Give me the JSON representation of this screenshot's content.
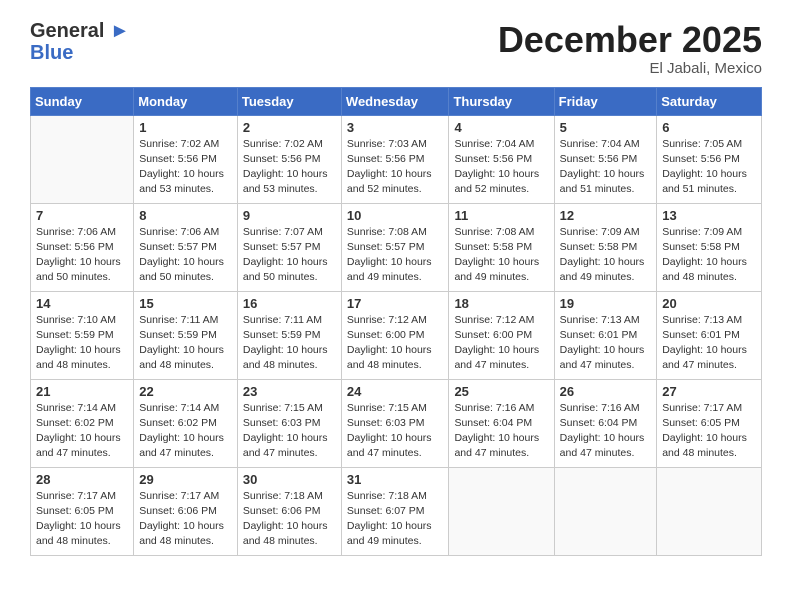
{
  "header": {
    "logo_line1": "General",
    "logo_line2": "Blue",
    "title": "December 2025",
    "subtitle": "El Jabali, Mexico"
  },
  "days_of_week": [
    "Sunday",
    "Monday",
    "Tuesday",
    "Wednesday",
    "Thursday",
    "Friday",
    "Saturday"
  ],
  "weeks": [
    [
      {
        "day": "",
        "info": ""
      },
      {
        "day": "1",
        "info": "Sunrise: 7:02 AM\nSunset: 5:56 PM\nDaylight: 10 hours\nand 53 minutes."
      },
      {
        "day": "2",
        "info": "Sunrise: 7:02 AM\nSunset: 5:56 PM\nDaylight: 10 hours\nand 53 minutes."
      },
      {
        "day": "3",
        "info": "Sunrise: 7:03 AM\nSunset: 5:56 PM\nDaylight: 10 hours\nand 52 minutes."
      },
      {
        "day": "4",
        "info": "Sunrise: 7:04 AM\nSunset: 5:56 PM\nDaylight: 10 hours\nand 52 minutes."
      },
      {
        "day": "5",
        "info": "Sunrise: 7:04 AM\nSunset: 5:56 PM\nDaylight: 10 hours\nand 51 minutes."
      },
      {
        "day": "6",
        "info": "Sunrise: 7:05 AM\nSunset: 5:56 PM\nDaylight: 10 hours\nand 51 minutes."
      }
    ],
    [
      {
        "day": "7",
        "info": "Sunrise: 7:06 AM\nSunset: 5:56 PM\nDaylight: 10 hours\nand 50 minutes."
      },
      {
        "day": "8",
        "info": "Sunrise: 7:06 AM\nSunset: 5:57 PM\nDaylight: 10 hours\nand 50 minutes."
      },
      {
        "day": "9",
        "info": "Sunrise: 7:07 AM\nSunset: 5:57 PM\nDaylight: 10 hours\nand 50 minutes."
      },
      {
        "day": "10",
        "info": "Sunrise: 7:08 AM\nSunset: 5:57 PM\nDaylight: 10 hours\nand 49 minutes."
      },
      {
        "day": "11",
        "info": "Sunrise: 7:08 AM\nSunset: 5:58 PM\nDaylight: 10 hours\nand 49 minutes."
      },
      {
        "day": "12",
        "info": "Sunrise: 7:09 AM\nSunset: 5:58 PM\nDaylight: 10 hours\nand 49 minutes."
      },
      {
        "day": "13",
        "info": "Sunrise: 7:09 AM\nSunset: 5:58 PM\nDaylight: 10 hours\nand 48 minutes."
      }
    ],
    [
      {
        "day": "14",
        "info": "Sunrise: 7:10 AM\nSunset: 5:59 PM\nDaylight: 10 hours\nand 48 minutes."
      },
      {
        "day": "15",
        "info": "Sunrise: 7:11 AM\nSunset: 5:59 PM\nDaylight: 10 hours\nand 48 minutes."
      },
      {
        "day": "16",
        "info": "Sunrise: 7:11 AM\nSunset: 5:59 PM\nDaylight: 10 hours\nand 48 minutes."
      },
      {
        "day": "17",
        "info": "Sunrise: 7:12 AM\nSunset: 6:00 PM\nDaylight: 10 hours\nand 48 minutes."
      },
      {
        "day": "18",
        "info": "Sunrise: 7:12 AM\nSunset: 6:00 PM\nDaylight: 10 hours\nand 47 minutes."
      },
      {
        "day": "19",
        "info": "Sunrise: 7:13 AM\nSunset: 6:01 PM\nDaylight: 10 hours\nand 47 minutes."
      },
      {
        "day": "20",
        "info": "Sunrise: 7:13 AM\nSunset: 6:01 PM\nDaylight: 10 hours\nand 47 minutes."
      }
    ],
    [
      {
        "day": "21",
        "info": "Sunrise: 7:14 AM\nSunset: 6:02 PM\nDaylight: 10 hours\nand 47 minutes."
      },
      {
        "day": "22",
        "info": "Sunrise: 7:14 AM\nSunset: 6:02 PM\nDaylight: 10 hours\nand 47 minutes."
      },
      {
        "day": "23",
        "info": "Sunrise: 7:15 AM\nSunset: 6:03 PM\nDaylight: 10 hours\nand 47 minutes."
      },
      {
        "day": "24",
        "info": "Sunrise: 7:15 AM\nSunset: 6:03 PM\nDaylight: 10 hours\nand 47 minutes."
      },
      {
        "day": "25",
        "info": "Sunrise: 7:16 AM\nSunset: 6:04 PM\nDaylight: 10 hours\nand 47 minutes."
      },
      {
        "day": "26",
        "info": "Sunrise: 7:16 AM\nSunset: 6:04 PM\nDaylight: 10 hours\nand 47 minutes."
      },
      {
        "day": "27",
        "info": "Sunrise: 7:17 AM\nSunset: 6:05 PM\nDaylight: 10 hours\nand 48 minutes."
      }
    ],
    [
      {
        "day": "28",
        "info": "Sunrise: 7:17 AM\nSunset: 6:05 PM\nDaylight: 10 hours\nand 48 minutes."
      },
      {
        "day": "29",
        "info": "Sunrise: 7:17 AM\nSunset: 6:06 PM\nDaylight: 10 hours\nand 48 minutes."
      },
      {
        "day": "30",
        "info": "Sunrise: 7:18 AM\nSunset: 6:06 PM\nDaylight: 10 hours\nand 48 minutes."
      },
      {
        "day": "31",
        "info": "Sunrise: 7:18 AM\nSunset: 6:07 PM\nDaylight: 10 hours\nand 49 minutes."
      },
      {
        "day": "",
        "info": ""
      },
      {
        "day": "",
        "info": ""
      },
      {
        "day": "",
        "info": ""
      }
    ]
  ]
}
